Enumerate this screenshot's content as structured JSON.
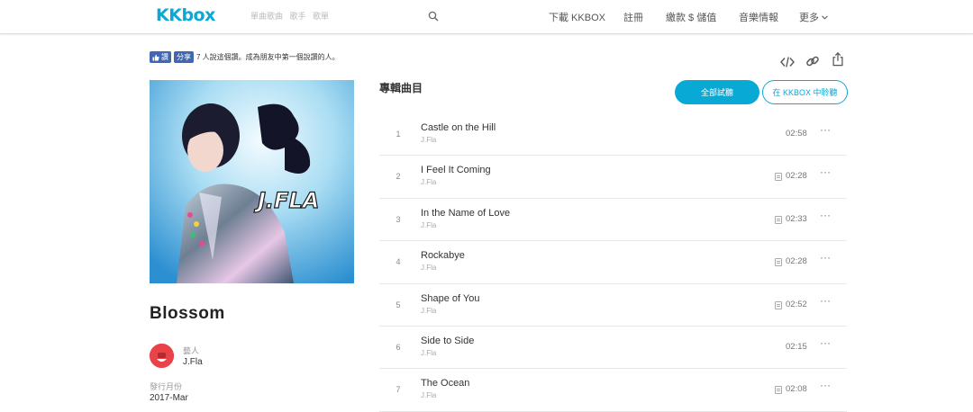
{
  "header": {
    "logo": "KKbox",
    "search_placeholder": "單曲歌曲   歌手   歌單",
    "nav": [
      "下載 KKBOX",
      "註冊",
      "繳款 $ 儲值",
      "音樂情報",
      "更多"
    ]
  },
  "social": {
    "like_label": "讚",
    "share_label": "分享",
    "like_text": "7 人說這個讚。成為朋友中第一個說讚的人。"
  },
  "album": {
    "cover_text": "J.FLA",
    "title": "Blossom",
    "artist_label": "藝人",
    "artist_name": "J.Fla",
    "release_label": "發行月份",
    "release_date": "2017-Mar"
  },
  "tracklist": {
    "title": "專輯曲目",
    "play_all": "全部試聽",
    "listen_in_app": "在 KKBOX 中聆聽",
    "tracks": [
      {
        "num": "1",
        "title": "Castle on the Hill",
        "artist": "J.Fla",
        "duration": "02:58",
        "lyrics": false
      },
      {
        "num": "2",
        "title": "I Feel It Coming",
        "artist": "J.Fla",
        "duration": "02:28",
        "lyrics": true
      },
      {
        "num": "3",
        "title": "In the Name of Love",
        "artist": "J.Fla",
        "duration": "02:33",
        "lyrics": true
      },
      {
        "num": "4",
        "title": "Rockabye",
        "artist": "J.Fla",
        "duration": "02:28",
        "lyrics": true
      },
      {
        "num": "5",
        "title": "Shape of You",
        "artist": "J.Fla",
        "duration": "02:52",
        "lyrics": true
      },
      {
        "num": "6",
        "title": "Side to Side",
        "artist": "J.Fla",
        "duration": "02:15",
        "lyrics": false
      },
      {
        "num": "7",
        "title": "The Ocean",
        "artist": "J.Fla",
        "duration": "02:08",
        "lyrics": true
      }
    ]
  },
  "more_glyph": "···",
  "colors": {
    "accent": "#09a9d6",
    "facebook": "#4267b2",
    "avatar": "#e9434a"
  }
}
